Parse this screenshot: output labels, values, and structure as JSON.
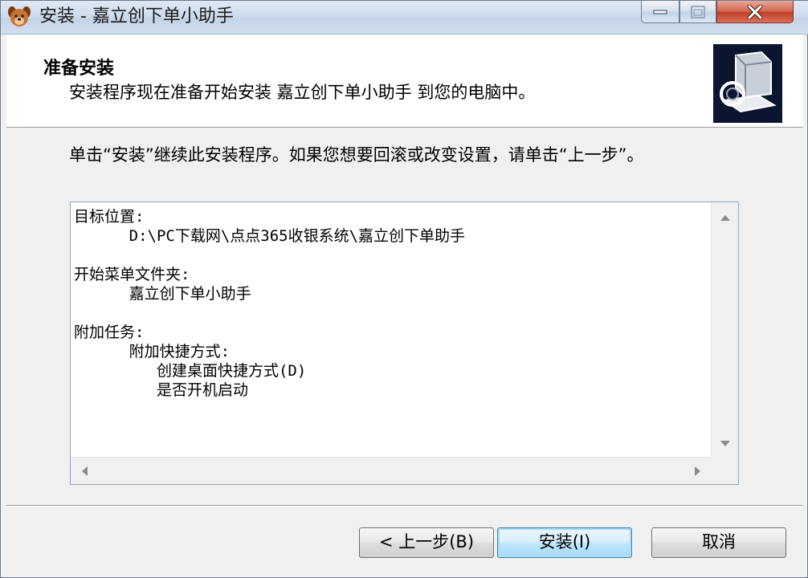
{
  "titlebar": {
    "title": "安装 - 嘉立创下单小助手"
  },
  "header": {
    "title": "准备安装",
    "subtitle": "安装程序现在准备开始安装 嘉立创下单小助手 到您的电脑中。"
  },
  "body": {
    "intro": "单击“安装”继续此安装程序。如果您想要回滚或改变设置，请单击“上一步”。",
    "memo": "目标位置:\n      D:\\PC下载网\\点点365收银系统\\嘉立创下单助手\n\n开始菜单文件夹:\n      嘉立创下单小助手\n\n附加任务:\n      附加快捷方式:\n         创建桌面快捷方式(D)\n         是否开机启动"
  },
  "buttons": {
    "back": "< 上一步(B)",
    "install": "安装(I)",
    "cancel": "取消"
  },
  "icons": {
    "app": "dog-face-icon",
    "setup": "computer-disk-icon"
  }
}
